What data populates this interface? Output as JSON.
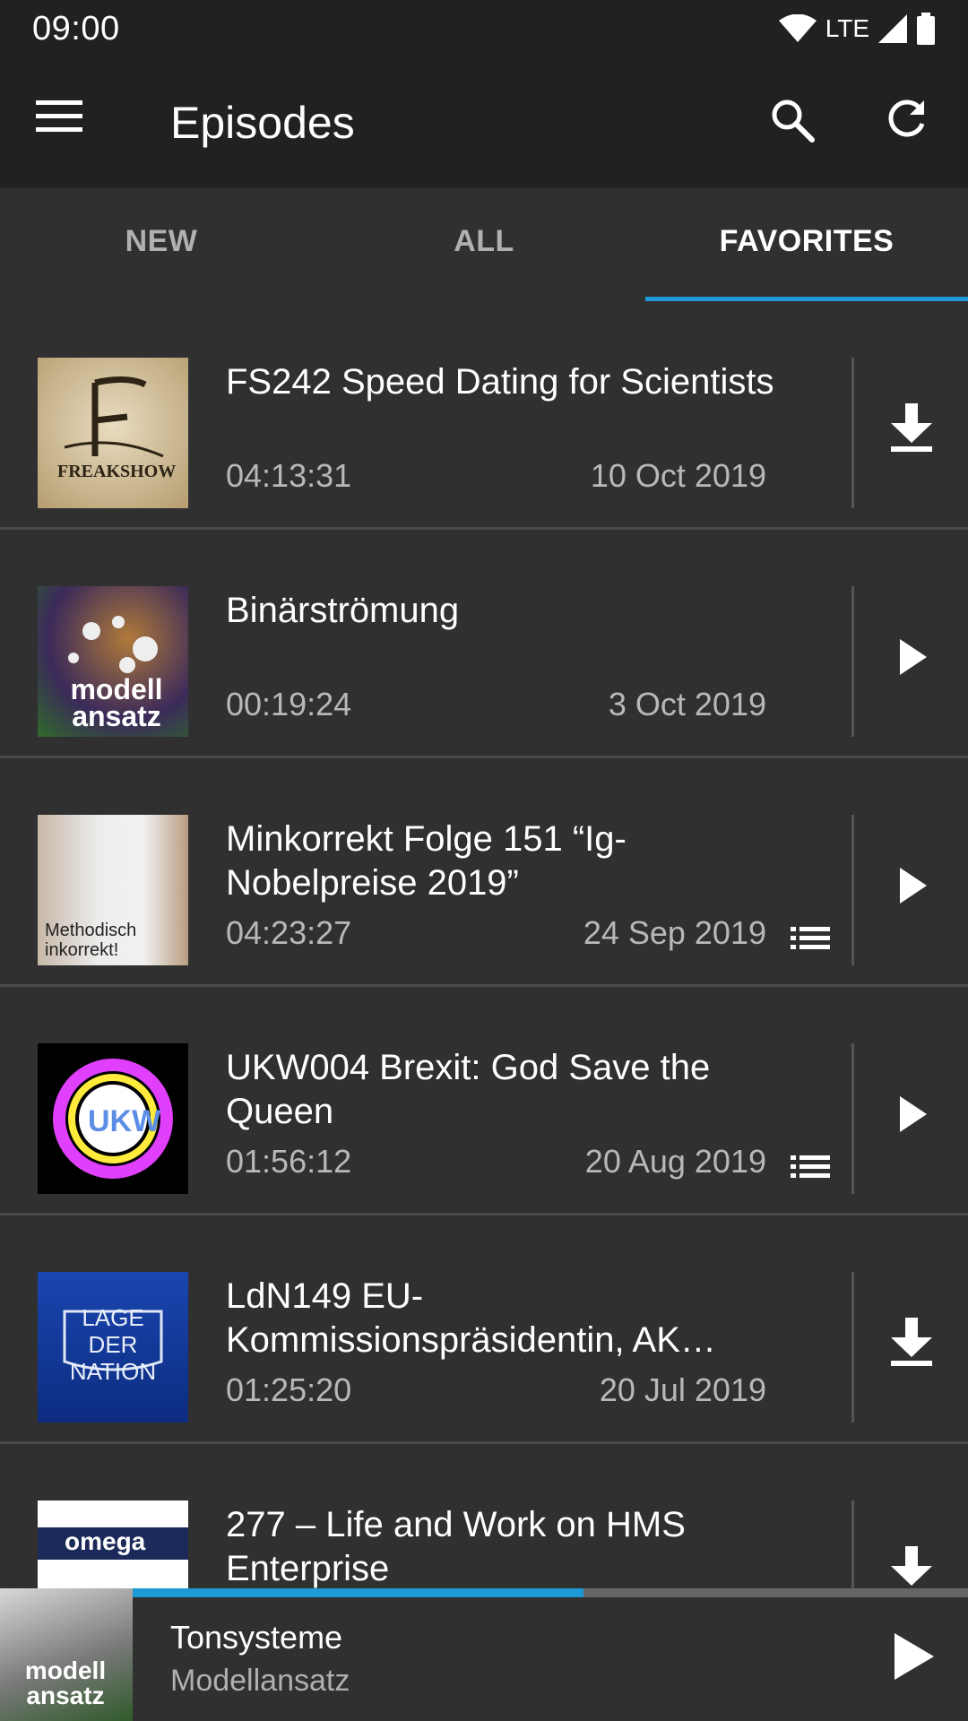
{
  "status_bar": {
    "time": "09:00",
    "network": "LTE"
  },
  "app_bar": {
    "title": "Episodes",
    "icons": [
      "menu-icon",
      "search-icon",
      "refresh-icon"
    ]
  },
  "tabs": [
    {
      "label": "NEW",
      "active": false
    },
    {
      "label": "ALL",
      "active": false
    },
    {
      "label": "FAVORITES",
      "active": true
    }
  ],
  "episodes": [
    {
      "title": "FS242 Speed Dating for Scientists",
      "duration": "04:13:31",
      "date": "10 Oct 2019",
      "action": "download-icon",
      "has_chapters": false,
      "thumb_text": "FREAKSHOW"
    },
    {
      "title": "Binärströmung",
      "duration": "00:19:24",
      "date": "3 Oct 2019",
      "action": "play-icon",
      "has_chapters": false,
      "thumb_text": "modell ansatz"
    },
    {
      "title": "Minkorrekt Folge 151 “Ig-Nobelpreise 2019”",
      "duration": "04:23:27",
      "date": "24 Sep 2019",
      "action": "play-icon",
      "has_chapters": true,
      "thumb_text": "Methodisch inkorrekt!"
    },
    {
      "title": "UKW004 Brexit: God Save the Queen",
      "duration": "01:56:12",
      "date": "20 Aug 2019",
      "action": "play-icon",
      "has_chapters": true,
      "thumb_text": "UKW"
    },
    {
      "title": "LdN149 EU-Kommissionspräsidentin, AK…",
      "duration": "01:25:20",
      "date": "20 Jul 2019",
      "action": "download-icon",
      "has_chapters": false,
      "thumb_text": "LAGE DER NATION"
    },
    {
      "title": "277 – Life and Work on HMS Enterprise",
      "duration": "",
      "date": "",
      "action": "download-icon",
      "has_chapters": false,
      "thumb_text": "omega tau"
    }
  ],
  "player": {
    "title": "Tonsysteme",
    "subtitle": "Modellansatz",
    "progress": 0.54,
    "thumb_text": "modell ansatz"
  },
  "colors": {
    "accent": "#1e9ad6",
    "toolbar": "#212121",
    "background": "#303030"
  }
}
